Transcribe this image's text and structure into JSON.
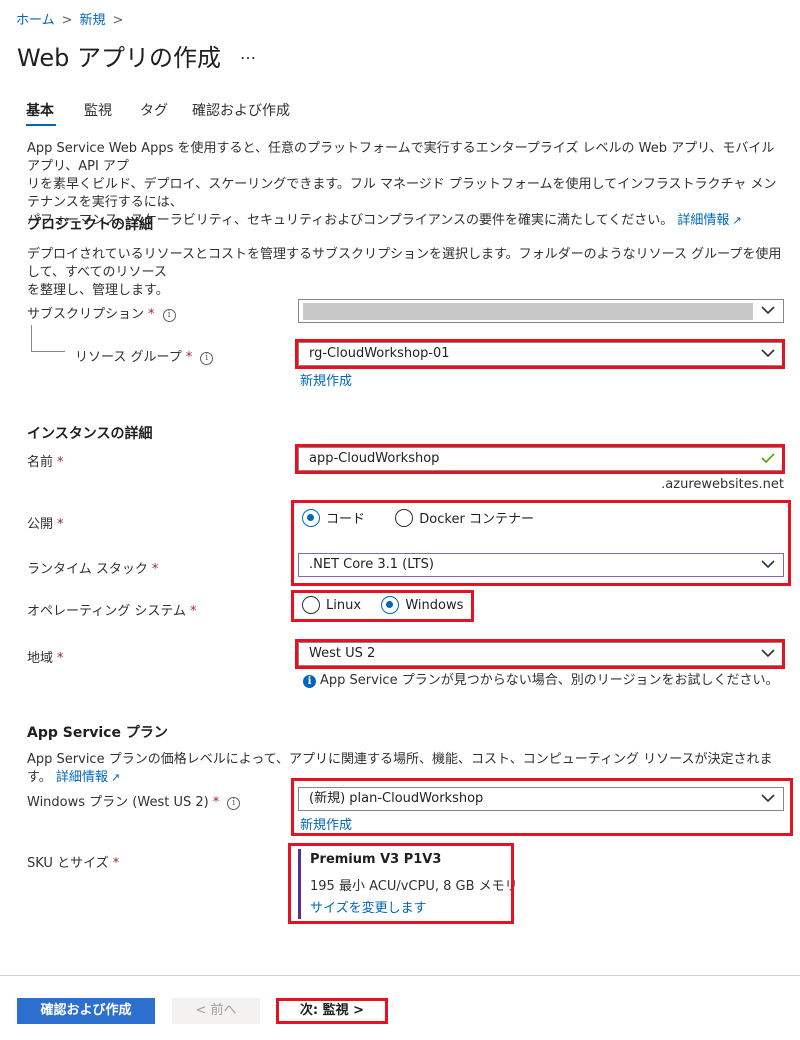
{
  "breadcrumb": {
    "home": "ホーム",
    "new": "新規"
  },
  "page_title": "Web アプリの作成",
  "more": "…",
  "tabs": [
    {
      "label": "基本",
      "active": true
    },
    {
      "label": "監視",
      "active": false
    },
    {
      "label": "タグ",
      "active": false
    },
    {
      "label": "確認および作成",
      "active": false
    }
  ],
  "intro": {
    "line1": "App Service Web Apps を使用すると、任意のプラットフォームで実行するエンタープライズ レベルの Web アプリ、モバイル アプリ、API アプ",
    "line2": "リを素早くビルド、デプロイ、スケーリングできます。フル マネージド プラットフォームを使用してインフラストラクチャ メンテナンスを実行するには、",
    "line3": "パフォーマンス、スケーラビリティ、セキュリティおよびコンプライアンスの要件を確実に満たしてください。",
    "more_info": "詳細情報"
  },
  "project": {
    "heading": "プロジェクトの詳細",
    "desc1": "デプロイされているリソースとコストを管理するサブスクリプションを選択します。フォルダーのようなリソース グループを使用して、すべてのリソース",
    "desc2": "を整理し、管理します。",
    "subscription_label": "サブスクリプション",
    "resource_group_label": "リソース グループ",
    "resource_group_value": "rg-CloudWorkshop-01",
    "create_new": "新規作成"
  },
  "instance": {
    "heading": "インスタンスの詳細",
    "name_label": "名前",
    "name_value": "app-CloudWorkshop",
    "name_suffix": ".azurewebsites.net",
    "publish_label": "公開",
    "publish_options": [
      "コード",
      "Docker コンテナー"
    ],
    "publish_selected": "コード",
    "runtime_label": "ランタイム スタック",
    "runtime_value": ".NET Core 3.1 (LTS)",
    "os_label": "オペレーティング システム",
    "os_options": [
      "Linux",
      "Windows"
    ],
    "os_selected": "Windows",
    "region_label": "地域",
    "region_value": "West US 2",
    "region_info": "App Service プランが見つからない場合、別のリージョンをお試しください。"
  },
  "plan": {
    "heading": "App Service プラン",
    "desc": "App Service プランの価格レベルによって、アプリに関連する場所、機能、コスト、コンピューティング リソースが決定されます。",
    "more_info": "詳細情報",
    "windows_plan_label": "Windows プラン (West US 2)",
    "windows_plan_value": "(新規) plan-CloudWorkshop",
    "create_new": "新規作成",
    "sku_label": "SKU とサイズ",
    "sku_name": "Premium V3 P1V3",
    "sku_detail": "195 最小 ACU/vCPU, 8 GB メモリ",
    "change_size": "サイズを変更します"
  },
  "footer": {
    "review_create": "確認および作成",
    "prev": "< 前へ",
    "next": "次: 監視 >"
  },
  "colors": {
    "accent": "#0067b8",
    "highlight": "#e81123",
    "primary_button": "#2d6fcf"
  }
}
